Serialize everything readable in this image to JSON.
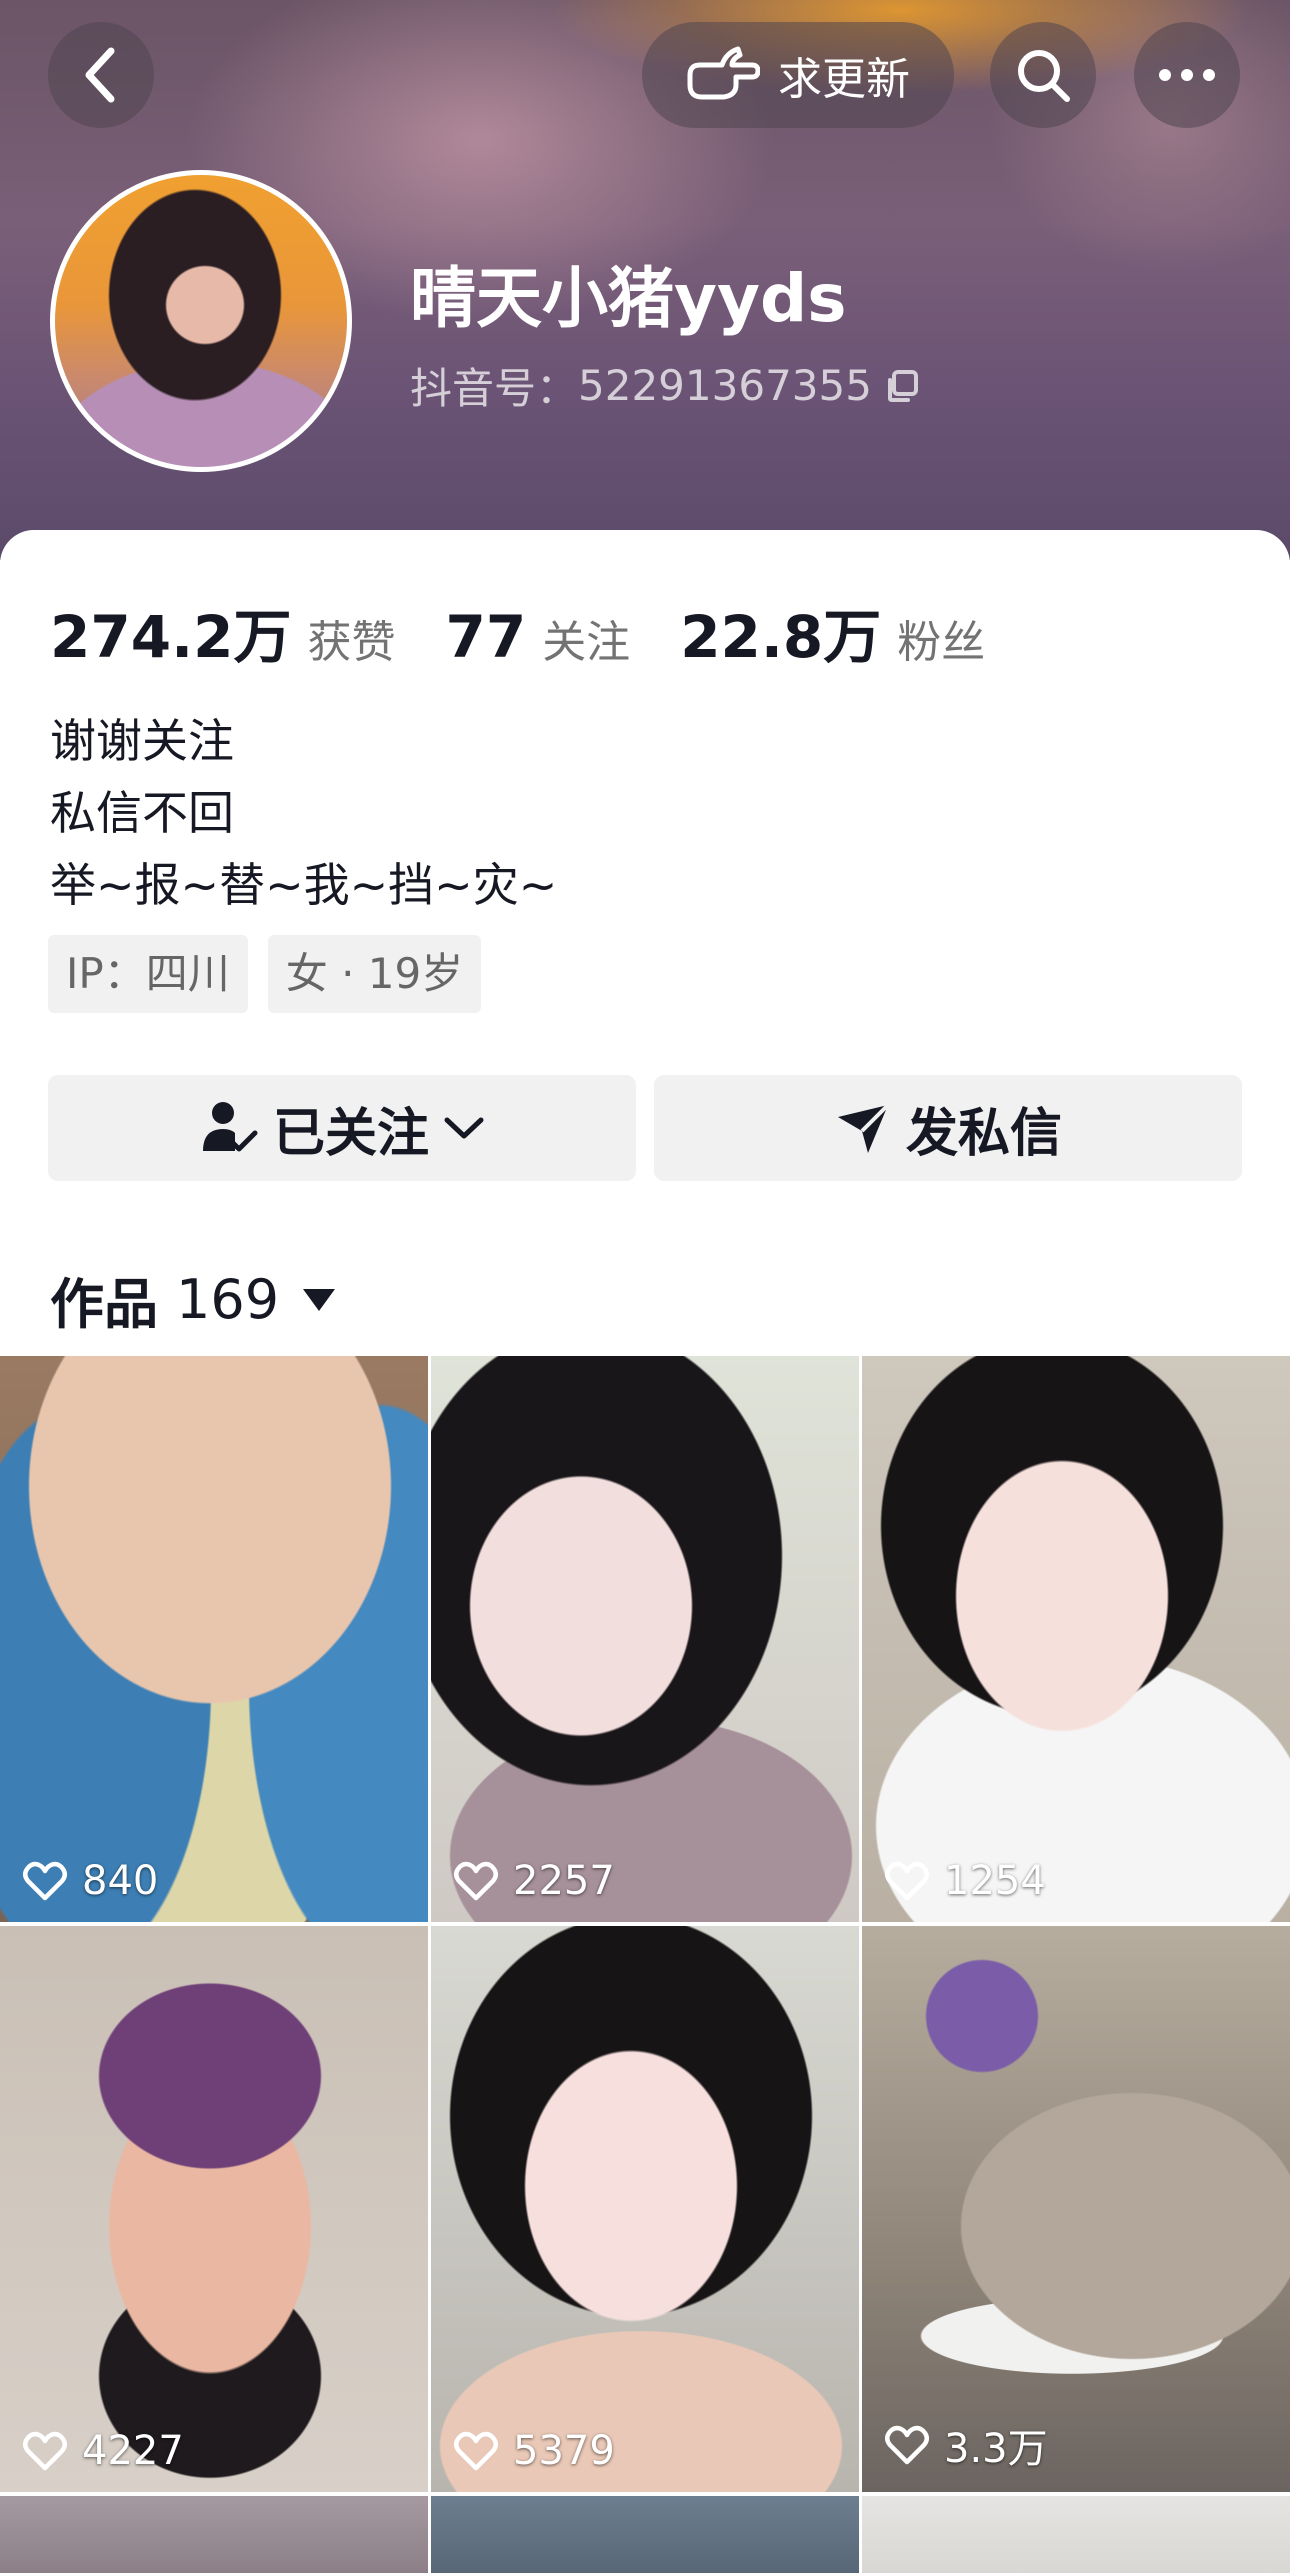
{
  "header": {
    "back_icon": "chevron-left-icon",
    "request_update_label": "求更新",
    "request_update_icon": "pointing-hand-icon",
    "search_icon": "search-icon",
    "more_icon": "more-horizontal-icon"
  },
  "profile": {
    "nickname": "晴天小猪yyds",
    "douyin_id_label": "抖音号：",
    "douyin_id": "52291367355",
    "copy_icon": "copy-icon"
  },
  "stats": [
    {
      "value": "274.2万",
      "label": "获赞"
    },
    {
      "value": "77",
      "label": "关注"
    },
    {
      "value": "22.8万",
      "label": "粉丝"
    }
  ],
  "bio": [
    "谢谢关注",
    "私信不回",
    "举~报~替~我~挡~灾~"
  ],
  "tags": [
    "IP：四川",
    "女 · 19岁"
  ],
  "actions": {
    "follow_label": "已关注",
    "message_label": "发私信"
  },
  "works": {
    "label": "作品",
    "count": "169"
  },
  "grid": [
    {
      "likes": "840"
    },
    {
      "likes": "2257"
    },
    {
      "likes": "1254"
    },
    {
      "likes": "4227"
    },
    {
      "likes": "5379"
    },
    {
      "likes": "3.3万"
    }
  ],
  "colors": {
    "text_primary": "#161823",
    "text_secondary": "#737373",
    "button_bg": "#f1f1f2"
  }
}
